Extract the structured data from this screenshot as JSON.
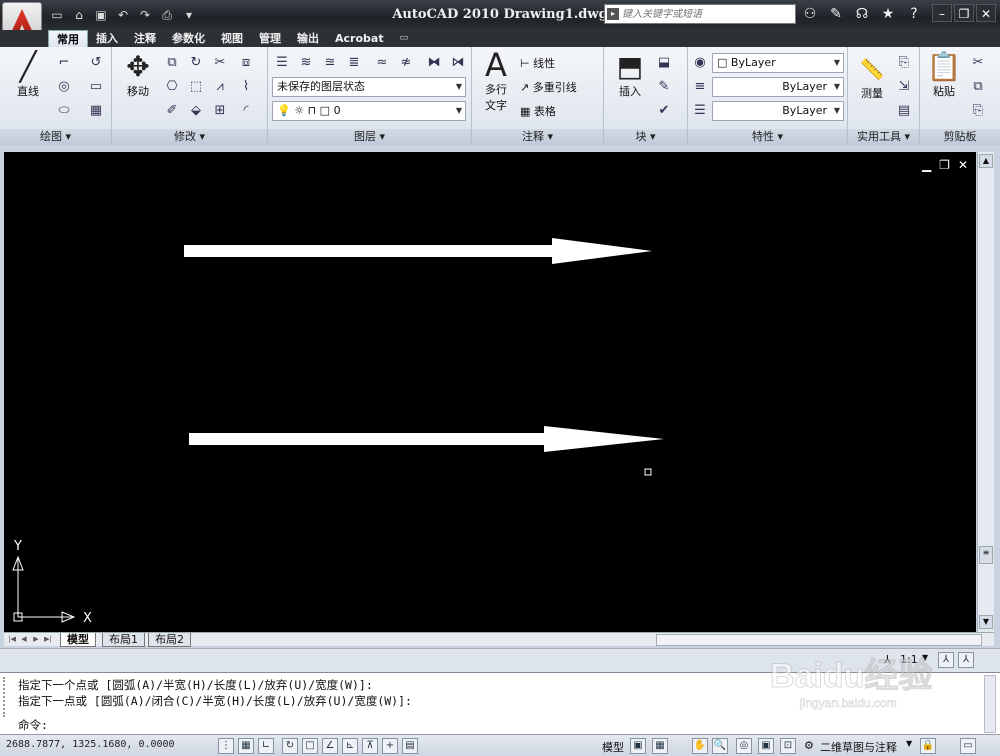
{
  "app": {
    "title": "AutoCAD 2010   Drawing1.dwg",
    "search_placeholder": "键入关键字或短语"
  },
  "tabs": [
    {
      "label": "常用",
      "active": true
    },
    {
      "label": "插入"
    },
    {
      "label": "注释"
    },
    {
      "label": "参数化"
    },
    {
      "label": "视图"
    },
    {
      "label": "管理"
    },
    {
      "label": "输出"
    },
    {
      "label": "Acrobat"
    }
  ],
  "panels": {
    "draw": {
      "title": "绘图 ▾",
      "line_label": "直线"
    },
    "modify": {
      "title": "修改 ▾",
      "move_label": "移动"
    },
    "layers": {
      "title": "图层 ▾",
      "layer_state": "未保存的图层状态",
      "current_layer": "0"
    },
    "annotation": {
      "title": "注释 ▾",
      "text_label_1": "多行",
      "text_label_2": "文字",
      "linear_label": "线性",
      "mleader_label": "多重引线",
      "table_label": "表格"
    },
    "block": {
      "title": "块 ▾",
      "insert_label": "插入"
    },
    "properties": {
      "title": "特性 ▾",
      "color": "ByLayer",
      "linetype": "ByLayer",
      "lineweight": "ByLayer"
    },
    "utilities": {
      "title": "实用工具 ▾",
      "measure_label": "测量"
    },
    "clipboard": {
      "title": "剪贴板",
      "paste_label": "粘贴"
    }
  },
  "layout_tabs": [
    {
      "label": "模型",
      "active": true
    },
    {
      "label": "布局1"
    },
    {
      "label": "布局2"
    }
  ],
  "annotation_scale": "1:1",
  "command": {
    "history": [
      "指定下一个点或 [圆弧(A)/半宽(H)/长度(L)/放弃(U)/宽度(W)]:",
      "指定下一点或 [圆弧(A)/闭合(C)/半宽(H)/长度(L)/放弃(U)/宽度(W)]:"
    ],
    "prompt": "命令:"
  },
  "status": {
    "coordinates": "2688.7877, 1325.1680, 0.0000",
    "model_label": "模型",
    "workspace": "二维草图与注释"
  },
  "ucs": {
    "x_label": "X",
    "y_label": "Y"
  },
  "watermark": {
    "text": "Baidu经验",
    "sub": "jingyan.baidu.com"
  }
}
